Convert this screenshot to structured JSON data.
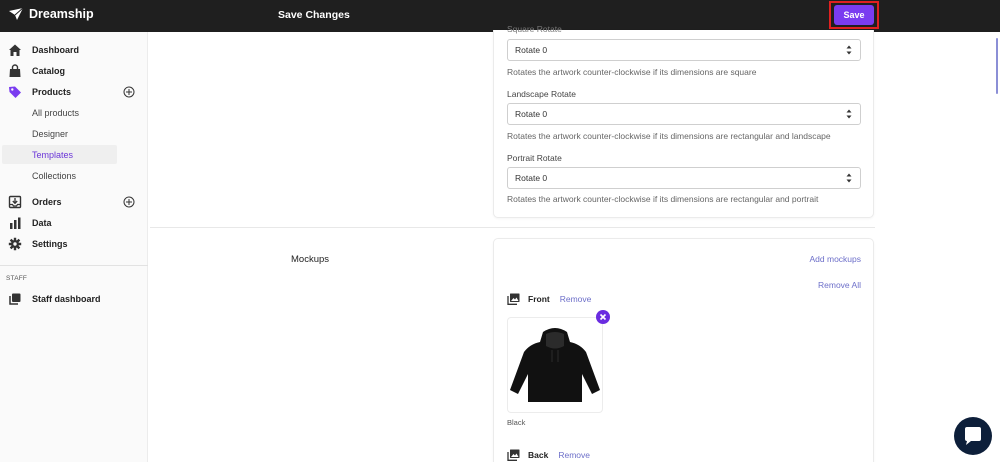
{
  "app": {
    "name": "Dreamship"
  },
  "header": {
    "title": "Save Changes",
    "save_label": "Save"
  },
  "sidebar": {
    "items": [
      {
        "label": "Dashboard",
        "icon": "home-icon"
      },
      {
        "label": "Catalog",
        "icon": "bag-icon"
      },
      {
        "label": "Products",
        "icon": "tag-icon"
      },
      {
        "label": "Orders",
        "icon": "inbox-icon"
      },
      {
        "label": "Data",
        "icon": "bar-chart-icon"
      },
      {
        "label": "Settings",
        "icon": "gear-icon"
      }
    ],
    "product_subitems": [
      "All products",
      "Designer",
      "Templates",
      "Collections"
    ],
    "active_subitem": "Templates",
    "staff_section": "STAFF",
    "staff_item": {
      "label": "Staff dashboard",
      "icon": "stack-icon"
    }
  },
  "rotate_settings": {
    "square_label": "Square Rotate",
    "square_value": "Rotate 0",
    "square_help": "Rotates the artwork counter-clockwise if its dimensions are square",
    "landscape_label": "Landscape Rotate",
    "landscape_value": "Rotate 0",
    "landscape_help": "Rotates the artwork counter-clockwise if its dimensions are rectangular and landscape",
    "portrait_label": "Portrait Rotate",
    "portrait_value": "Rotate 0",
    "portrait_help": "Rotates the artwork counter-clockwise if its dimensions are rectangular and portrait"
  },
  "mockups": {
    "title": "Mockups",
    "add_label": "Add mockups",
    "remove_all_label": "Remove All",
    "views": [
      {
        "name": "Front",
        "remove_label": "Remove",
        "thumb_caption": "Black"
      },
      {
        "name": "Back",
        "remove_label": "Remove"
      }
    ]
  },
  "colors": {
    "accent": "#7a3cf0",
    "topbar": "#1f1f1f",
    "link": "#6d6fc9",
    "highlight": "#e02020",
    "chat": "#0d1f3a"
  }
}
